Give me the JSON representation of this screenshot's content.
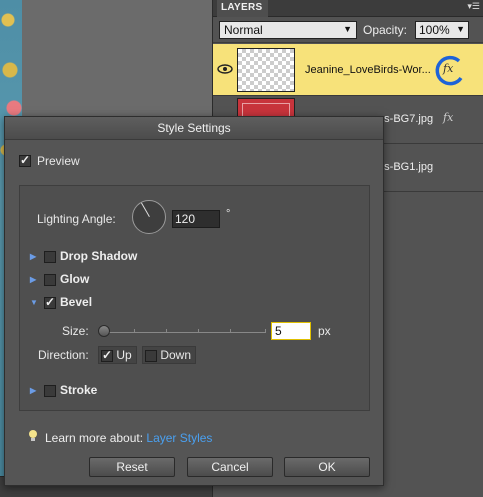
{
  "layers_panel": {
    "tab_label": "LAYERS",
    "blend_mode": "Normal",
    "opacity_label": "Opacity:",
    "opacity_value": "100%",
    "layers": [
      {
        "name": "Jeanine_LoveBirds-Wor...",
        "fx": "fx",
        "selected": true
      },
      {
        "name": "...s-BG7.jpg",
        "fx": "fx",
        "selected": false
      },
      {
        "name": "...s-BG1.jpg",
        "fx": "",
        "selected": false
      }
    ],
    "accent_color": "#f7e27a"
  },
  "dialog": {
    "title": "Style Settings",
    "preview": {
      "label": "Preview",
      "checked": true
    },
    "lighting_angle": {
      "label": "Lighting Angle:",
      "value": "120",
      "unit": "°"
    },
    "sections": [
      {
        "label": "Drop Shadow",
        "expanded": false,
        "checked": false
      },
      {
        "label": "Glow",
        "expanded": false,
        "checked": false
      },
      {
        "label": "Bevel",
        "expanded": true,
        "checked": true
      },
      {
        "label": "Stroke",
        "expanded": false,
        "checked": false
      }
    ],
    "bevel": {
      "size_label": "Size:",
      "size_value": "5",
      "size_unit": "px",
      "direction_label": "Direction:",
      "up_label": "Up",
      "up_checked": true,
      "down_label": "Down",
      "down_checked": false
    },
    "learn_more": {
      "text": "Learn more about:",
      "link": "Layer Styles"
    },
    "buttons": {
      "reset": "Reset",
      "cancel": "Cancel",
      "ok": "OK"
    },
    "link_color": "#4aa0f0"
  }
}
